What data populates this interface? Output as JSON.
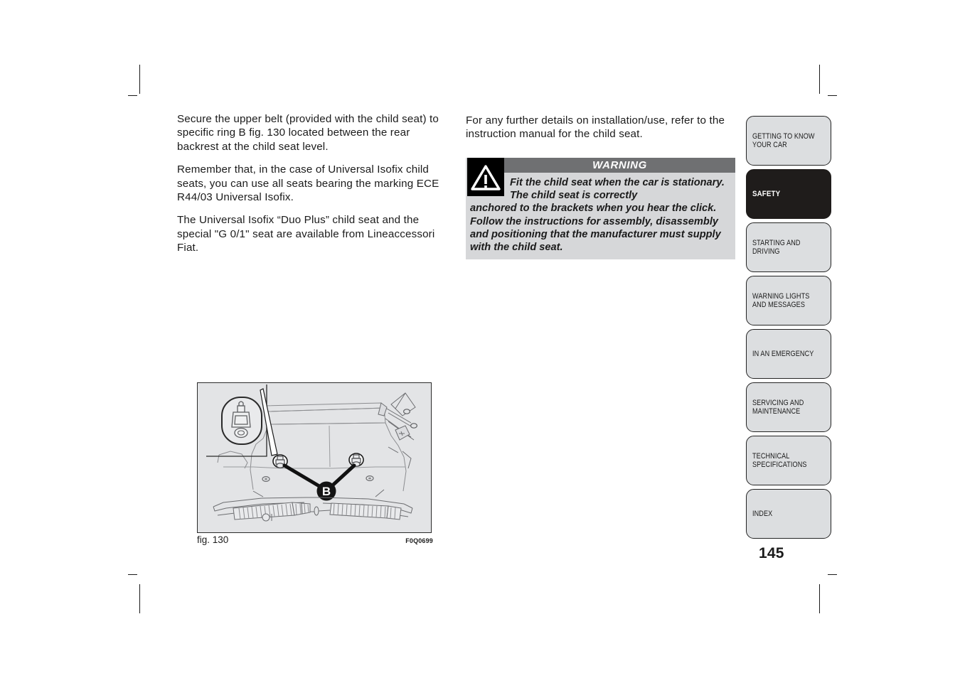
{
  "document": {
    "page_number": "145",
    "figure": {
      "caption": "fig. 130",
      "code": "F0Q0699",
      "callout_label": "B"
    }
  },
  "left_column": {
    "paragraphs": [
      "Secure the upper belt (provided with the child seat) to specific ring B fig. 130 located between the rear backrest at the child seat level.",
      "Remember that, in the case of Universal Isofix child seats, you can use all seats bearing the marking ECE R44/03 Universal Isofix.",
      "The Universal Isofix “Duo Plus” child seat and the special \"G 0/1\" seat are available from Lineaccessori Fiat."
    ]
  },
  "right_column": {
    "paragraphs": [
      "For any further details on installation/use, refer to the instruction manual for the child seat."
    ],
    "warning": {
      "header": "WARNING",
      "icon": "warning-triangle-icon",
      "text_indented": "Fit the child seat when the car is stationary. The child seat is correctly",
      "text_full": "anchored to the brackets when you hear the click. Follow the instructions for assembly, disassembly and positioning that the manufacturer must supply with the child seat.",
      "background_color": "#d6d7d9",
      "header_color": "#6f7072"
    }
  },
  "sidebar": {
    "tabs": [
      {
        "label": "GETTING TO KNOW\nYOUR CAR",
        "active": false
      },
      {
        "label": "SAFETY",
        "active": true
      },
      {
        "label": "STARTING AND\nDRIVING",
        "active": false
      },
      {
        "label": "WARNING LIGHTS\nAND MESSAGES",
        "active": false
      },
      {
        "label": "IN AN EMERGENCY",
        "active": false
      },
      {
        "label": "SERVICING AND\nMAINTENANCE",
        "active": false
      },
      {
        "label": "TECHNICAL\nSPECIFICATIONS",
        "active": false
      },
      {
        "label": "INDEX",
        "active": false
      }
    ],
    "active_color": "#1f1c1b",
    "inactive_color": "#dcdee0"
  }
}
